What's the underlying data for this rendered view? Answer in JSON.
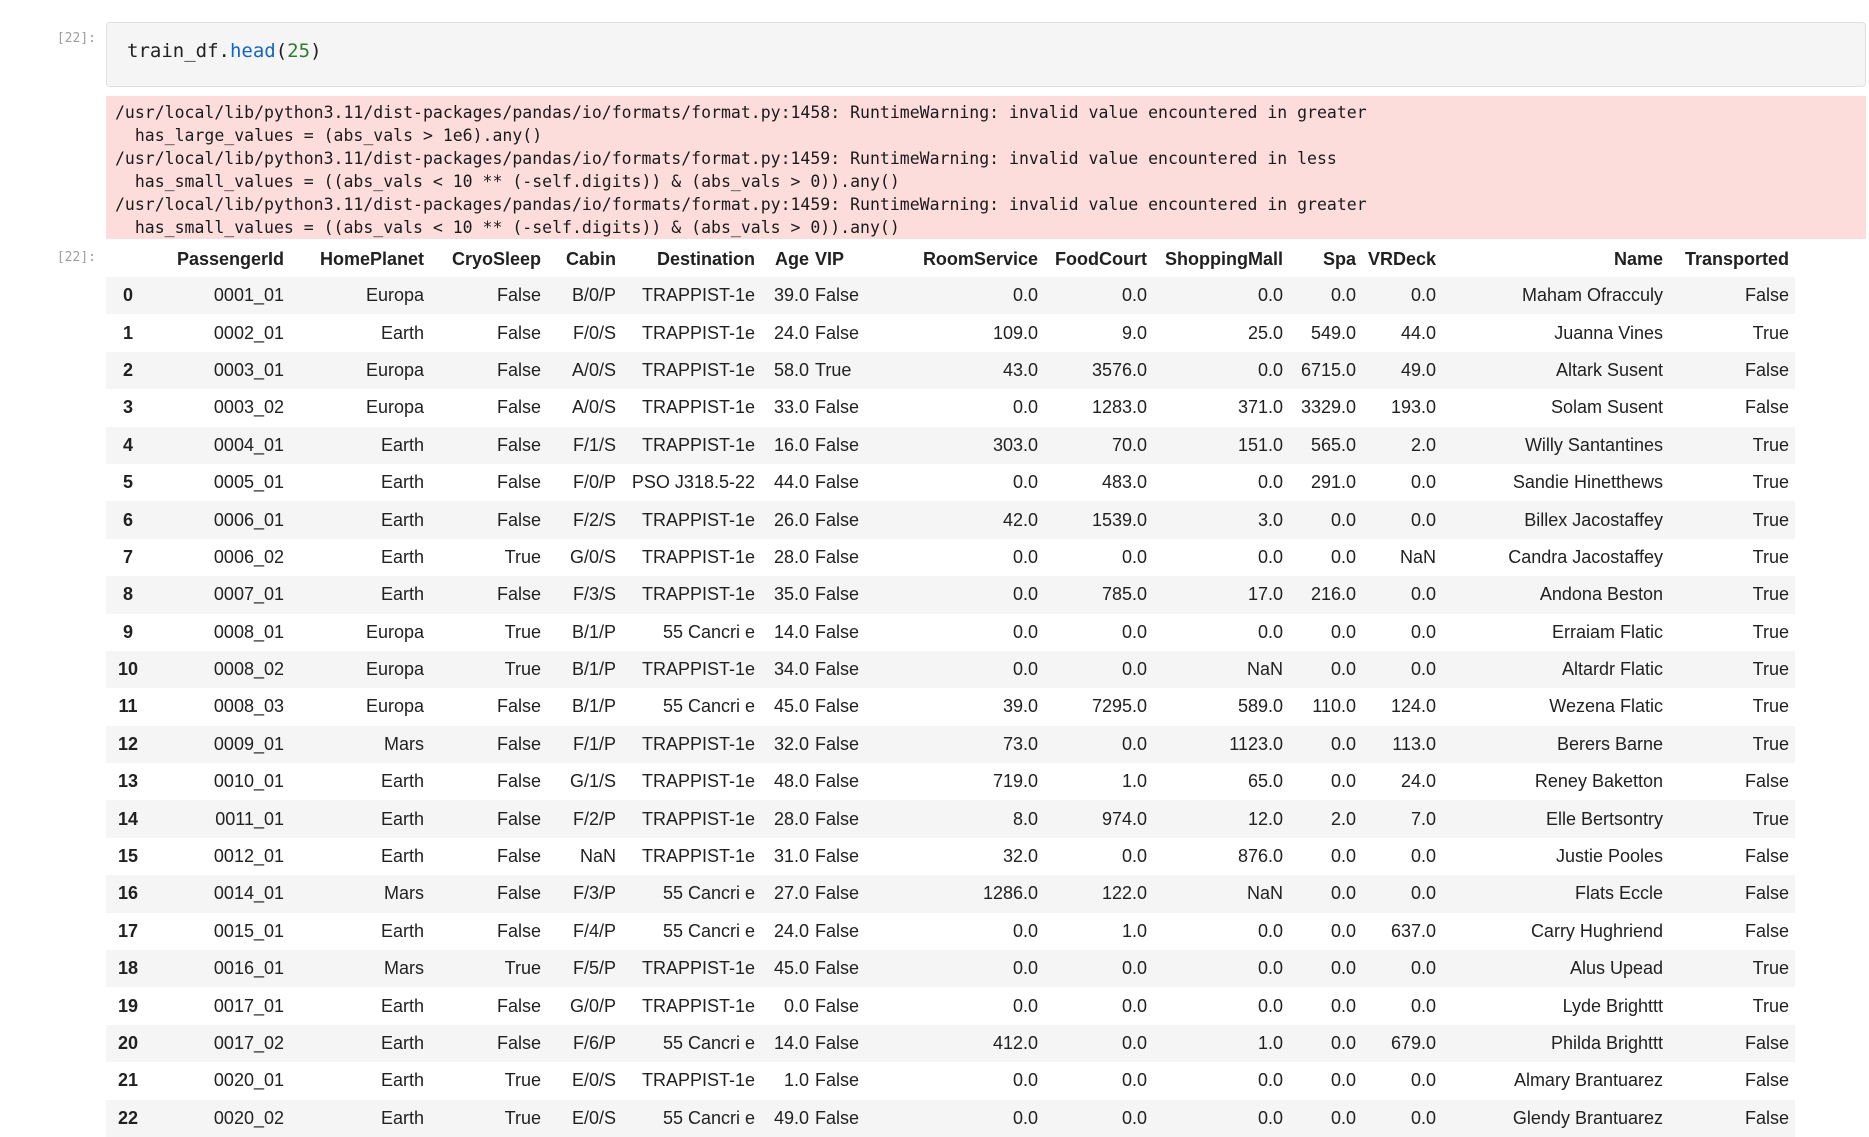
{
  "input_prompt": "[22]:",
  "output_prompt": "[22]:",
  "code": {
    "obj": "train_df.",
    "fn": "head",
    "open": "(",
    "arg": "25",
    "close": ")"
  },
  "stderr": [
    "/usr/local/lib/python3.11/dist-packages/pandas/io/formats/format.py:1458: RuntimeWarning: invalid value encountered in greater",
    "  has_large_values = (abs_vals > 1e6).any()",
    "/usr/local/lib/python3.11/dist-packages/pandas/io/formats/format.py:1459: RuntimeWarning: invalid value encountered in less",
    "  has_small_values = ((abs_vals < 10 ** (-self.digits)) & (abs_vals > 0)).any()",
    "/usr/local/lib/python3.11/dist-packages/pandas/io/formats/format.py:1459: RuntimeWarning: invalid value encountered in greater",
    "  has_small_values = ((abs_vals < 10 ** (-self.digits)) & (abs_vals > 0)).any()"
  ],
  "colors": {
    "stderr_bg": "#fddcdc",
    "cell_bg": "#f5f5f5",
    "stripe": "#f5f5f5"
  },
  "table": {
    "columns": [
      "",
      "PassengerId",
      "HomePlanet",
      "CryoSleep",
      "Cabin",
      "Destination",
      "Age",
      "VIP",
      "RoomService",
      "FoodCourt",
      "ShoppingMall",
      "Spa",
      "VRDeck",
      "Name",
      "Transported"
    ],
    "rows": [
      [
        "0",
        "0001_01",
        "Europa",
        "False",
        "B/0/P",
        "TRAPPIST-1e",
        "39.0",
        "False",
        "0.0",
        "0.0",
        "0.0",
        "0.0",
        "0.0",
        "Maham Ofracculy",
        "False"
      ],
      [
        "1",
        "0002_01",
        "Earth",
        "False",
        "F/0/S",
        "TRAPPIST-1e",
        "24.0",
        "False",
        "109.0",
        "9.0",
        "25.0",
        "549.0",
        "44.0",
        "Juanna Vines",
        "True"
      ],
      [
        "2",
        "0003_01",
        "Europa",
        "False",
        "A/0/S",
        "TRAPPIST-1e",
        "58.0",
        "True",
        "43.0",
        "3576.0",
        "0.0",
        "6715.0",
        "49.0",
        "Altark Susent",
        "False"
      ],
      [
        "3",
        "0003_02",
        "Europa",
        "False",
        "A/0/S",
        "TRAPPIST-1e",
        "33.0",
        "False",
        "0.0",
        "1283.0",
        "371.0",
        "3329.0",
        "193.0",
        "Solam Susent",
        "False"
      ],
      [
        "4",
        "0004_01",
        "Earth",
        "False",
        "F/1/S",
        "TRAPPIST-1e",
        "16.0",
        "False",
        "303.0",
        "70.0",
        "151.0",
        "565.0",
        "2.0",
        "Willy Santantines",
        "True"
      ],
      [
        "5",
        "0005_01",
        "Earth",
        "False",
        "F/0/P",
        "PSO J318.5-22",
        "44.0",
        "False",
        "0.0",
        "483.0",
        "0.0",
        "291.0",
        "0.0",
        "Sandie Hinetthews",
        "True"
      ],
      [
        "6",
        "0006_01",
        "Earth",
        "False",
        "F/2/S",
        "TRAPPIST-1e",
        "26.0",
        "False",
        "42.0",
        "1539.0",
        "3.0",
        "0.0",
        "0.0",
        "Billex Jacostaffey",
        "True"
      ],
      [
        "7",
        "0006_02",
        "Earth",
        "True",
        "G/0/S",
        "TRAPPIST-1e",
        "28.0",
        "False",
        "0.0",
        "0.0",
        "0.0",
        "0.0",
        "NaN",
        "Candra Jacostaffey",
        "True"
      ],
      [
        "8",
        "0007_01",
        "Earth",
        "False",
        "F/3/S",
        "TRAPPIST-1e",
        "35.0",
        "False",
        "0.0",
        "785.0",
        "17.0",
        "216.0",
        "0.0",
        "Andona Beston",
        "True"
      ],
      [
        "9",
        "0008_01",
        "Europa",
        "True",
        "B/1/P",
        "55 Cancri e",
        "14.0",
        "False",
        "0.0",
        "0.0",
        "0.0",
        "0.0",
        "0.0",
        "Erraiam Flatic",
        "True"
      ],
      [
        "10",
        "0008_02",
        "Europa",
        "True",
        "B/1/P",
        "TRAPPIST-1e",
        "34.0",
        "False",
        "0.0",
        "0.0",
        "NaN",
        "0.0",
        "0.0",
        "Altardr Flatic",
        "True"
      ],
      [
        "11",
        "0008_03",
        "Europa",
        "False",
        "B/1/P",
        "55 Cancri e",
        "45.0",
        "False",
        "39.0",
        "7295.0",
        "589.0",
        "110.0",
        "124.0",
        "Wezena Flatic",
        "True"
      ],
      [
        "12",
        "0009_01",
        "Mars",
        "False",
        "F/1/P",
        "TRAPPIST-1e",
        "32.0",
        "False",
        "73.0",
        "0.0",
        "1123.0",
        "0.0",
        "113.0",
        "Berers Barne",
        "True"
      ],
      [
        "13",
        "0010_01",
        "Earth",
        "False",
        "G/1/S",
        "TRAPPIST-1e",
        "48.0",
        "False",
        "719.0",
        "1.0",
        "65.0",
        "0.0",
        "24.0",
        "Reney Baketton",
        "False"
      ],
      [
        "14",
        "0011_01",
        "Earth",
        "False",
        "F/2/P",
        "TRAPPIST-1e",
        "28.0",
        "False",
        "8.0",
        "974.0",
        "12.0",
        "2.0",
        "7.0",
        "Elle Bertsontry",
        "True"
      ],
      [
        "15",
        "0012_01",
        "Earth",
        "False",
        "NaN",
        "TRAPPIST-1e",
        "31.0",
        "False",
        "32.0",
        "0.0",
        "876.0",
        "0.0",
        "0.0",
        "Justie Pooles",
        "False"
      ],
      [
        "16",
        "0014_01",
        "Mars",
        "False",
        "F/3/P",
        "55 Cancri e",
        "27.0",
        "False",
        "1286.0",
        "122.0",
        "NaN",
        "0.0",
        "0.0",
        "Flats Eccle",
        "False"
      ],
      [
        "17",
        "0015_01",
        "Earth",
        "False",
        "F/4/P",
        "55 Cancri e",
        "24.0",
        "False",
        "0.0",
        "1.0",
        "0.0",
        "0.0",
        "637.0",
        "Carry Hughriend",
        "False"
      ],
      [
        "18",
        "0016_01",
        "Mars",
        "True",
        "F/5/P",
        "TRAPPIST-1e",
        "45.0",
        "False",
        "0.0",
        "0.0",
        "0.0",
        "0.0",
        "0.0",
        "Alus Upead",
        "True"
      ],
      [
        "19",
        "0017_01",
        "Earth",
        "False",
        "G/0/P",
        "TRAPPIST-1e",
        "0.0",
        "False",
        "0.0",
        "0.0",
        "0.0",
        "0.0",
        "0.0",
        "Lyde Brighttt",
        "True"
      ],
      [
        "20",
        "0017_02",
        "Earth",
        "False",
        "F/6/P",
        "55 Cancri e",
        "14.0",
        "False",
        "412.0",
        "0.0",
        "1.0",
        "0.0",
        "679.0",
        "Philda Brighttt",
        "False"
      ],
      [
        "21",
        "0020_01",
        "Earth",
        "True",
        "E/0/S",
        "TRAPPIST-1e",
        "1.0",
        "False",
        "0.0",
        "0.0",
        "0.0",
        "0.0",
        "0.0",
        "Almary Brantuarez",
        "False"
      ],
      [
        "22",
        "0020_02",
        "Earth",
        "True",
        "E/0/S",
        "55 Cancri e",
        "49.0",
        "False",
        "0.0",
        "0.0",
        "0.0",
        "0.0",
        "0.0",
        "Glendy Brantuarez",
        "False"
      ]
    ]
  }
}
